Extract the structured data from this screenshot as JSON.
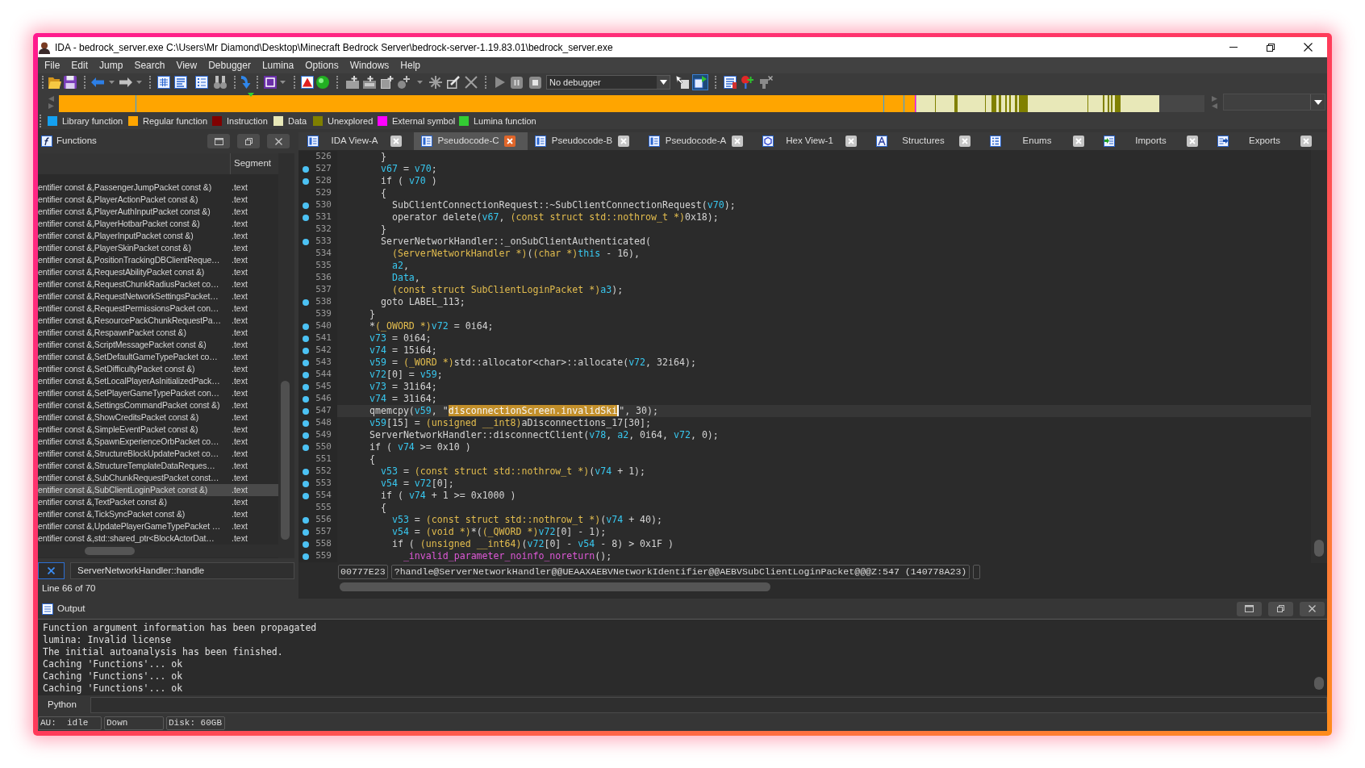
{
  "window": {
    "title": "IDA - bedrock_server.exe C:\\Users\\Mr Diamond\\Desktop\\Minecraft Bedrock Server\\bedrock-server-1.19.83.01\\bedrock_server.exe"
  },
  "menu": [
    "File",
    "Edit",
    "Jump",
    "Search",
    "View",
    "Debugger",
    "Lumina",
    "Options",
    "Windows",
    "Help"
  ],
  "toolbar": {
    "debugger": "No debugger"
  },
  "legend": [
    {
      "label": "Library function",
      "color": "#14a0f0"
    },
    {
      "label": "Regular function",
      "color": "#ffa500"
    },
    {
      "label": "Instruction",
      "color": "#800000"
    },
    {
      "label": "Data",
      "color": "#e8e8b8"
    },
    {
      "label": "Unexplored",
      "color": "#808000"
    },
    {
      "label": "External symbol",
      "color": "#ff00ff"
    },
    {
      "label": "Lumina function",
      "color": "#33cc33"
    }
  ],
  "functions_panel": {
    "title": "Functions",
    "segment_header": "Segment",
    "rows": [
      {
        "name": "entifier const &,PassengerJumpPacket const &)",
        "segment": ".text",
        "selected": false
      },
      {
        "name": "entifier const &,PlayerActionPacket const &)",
        "segment": ".text",
        "selected": false
      },
      {
        "name": "entifier const &,PlayerAuthInputPacket const &)",
        "segment": ".text",
        "selected": false
      },
      {
        "name": "entifier const &,PlayerHotbarPacket const &)",
        "segment": ".text",
        "selected": false
      },
      {
        "name": "entifier const &,PlayerInputPacket const &)",
        "segment": ".text",
        "selected": false
      },
      {
        "name": "entifier const &,PlayerSkinPacket const &)",
        "segment": ".text",
        "selected": false
      },
      {
        "name": "entifier const &,PositionTrackingDBClientReque…",
        "segment": ".text",
        "selected": false
      },
      {
        "name": "entifier const &,RequestAbilityPacket const &)",
        "segment": ".text",
        "selected": false
      },
      {
        "name": "entifier const &,RequestChunkRadiusPacket co…",
        "segment": ".text",
        "selected": false
      },
      {
        "name": "entifier const &,RequestNetworkSettingsPacket…",
        "segment": ".text",
        "selected": false
      },
      {
        "name": "entifier const &,RequestPermissionsPacket con…",
        "segment": ".text",
        "selected": false
      },
      {
        "name": "entifier const &,ResourcePackChunkRequestPa…",
        "segment": ".text",
        "selected": false
      },
      {
        "name": "entifier const &,RespawnPacket const &)",
        "segment": ".text",
        "selected": false
      },
      {
        "name": "entifier const &,ScriptMessagePacket const &)",
        "segment": ".text",
        "selected": false
      },
      {
        "name": "entifier const &,SetDefaultGameTypePacket co…",
        "segment": ".text",
        "selected": false
      },
      {
        "name": "entifier const &,SetDifficultyPacket const &)",
        "segment": ".text",
        "selected": false
      },
      {
        "name": "entifier const &,SetLocalPlayerAsInitializedPack…",
        "segment": ".text",
        "selected": false
      },
      {
        "name": "entifier const &,SetPlayerGameTypePacket con…",
        "segment": ".text",
        "selected": false
      },
      {
        "name": "entifier const &,SettingsCommandPacket const &)",
        "segment": ".text",
        "selected": false
      },
      {
        "name": "entifier const &,ShowCreditsPacket const &)",
        "segment": ".text",
        "selected": false
      },
      {
        "name": "entifier const &,SimpleEventPacket const &)",
        "segment": ".text",
        "selected": false
      },
      {
        "name": "entifier const &,SpawnExperienceOrbPacket co…",
        "segment": ".text",
        "selected": false
      },
      {
        "name": "entifier const &,StructureBlockUpdatePacket co…",
        "segment": ".text",
        "selected": false
      },
      {
        "name": "entifier const &,StructureTemplateDataReques…",
        "segment": ".text",
        "selected": false
      },
      {
        "name": "entifier const &,SubChunkRequestPacket const…",
        "segment": ".text",
        "selected": false
      },
      {
        "name": "entifier const &,SubClientLoginPacket const &)",
        "segment": ".text",
        "selected": true
      },
      {
        "name": "entifier const &,TextPacket const &)",
        "segment": ".text",
        "selected": false
      },
      {
        "name": "entifier const &,TickSyncPacket const &)",
        "segment": ".text",
        "selected": false
      },
      {
        "name": "entifier const &,UpdatePlayerGameTypePacket …",
        "segment": ".text",
        "selected": false
      },
      {
        "name": "entifier const &,std::shared_ptr<BlockActorDat…",
        "segment": ".text",
        "selected": false
      }
    ],
    "filter": "ServerNetworkHandler::handle",
    "status": "Line 66 of 70"
  },
  "tabs": [
    {
      "label": "IDA View-A",
      "selected": false
    },
    {
      "label": "Pseudocode-C",
      "selected": true
    },
    {
      "label": "Pseudocode-B",
      "selected": false
    },
    {
      "label": "Pseudocode-A",
      "selected": false
    },
    {
      "label": "Hex View-1",
      "selected": false
    },
    {
      "label": "Structures",
      "selected": false
    },
    {
      "label": "Enums",
      "selected": false
    },
    {
      "label": "Imports",
      "selected": false
    },
    {
      "label": "Exports",
      "selected": false
    }
  ],
  "pseudocode": {
    "lines": [
      {
        "number": "526",
        "marker": false,
        "current": false,
        "tokens": [
          {
            "kind": "plain",
            "text": "  }"
          }
        ]
      },
      {
        "number": "527",
        "marker": true,
        "current": false,
        "tokens": [
          {
            "kind": "var",
            "text": "  v67"
          },
          {
            "kind": "plain",
            "text": " = "
          },
          {
            "kind": "var",
            "text": "v70"
          },
          {
            "kind": "plain",
            "text": ";"
          }
        ]
      },
      {
        "number": "528",
        "marker": true,
        "current": false,
        "tokens": [
          {
            "kind": "plain",
            "text": "  if ( "
          },
          {
            "kind": "var",
            "text": "v70"
          },
          {
            "kind": "plain",
            "text": " )"
          }
        ]
      },
      {
        "number": "529",
        "marker": false,
        "current": false,
        "tokens": [
          {
            "kind": "plain",
            "text": "  {"
          }
        ]
      },
      {
        "number": "530",
        "marker": true,
        "current": false,
        "tokens": [
          {
            "kind": "plain",
            "text": "    SubClientConnectionRequest::~SubClientConnectionRequest("
          },
          {
            "kind": "var",
            "text": "v70"
          },
          {
            "kind": "plain",
            "text": ");"
          }
        ]
      },
      {
        "number": "531",
        "marker": true,
        "current": false,
        "tokens": [
          {
            "kind": "plain",
            "text": "    operator delete("
          },
          {
            "kind": "var",
            "text": "v67"
          },
          {
            "kind": "plain",
            "text": ", "
          },
          {
            "kind": "type",
            "text": "(const struct std::nothrow_t *)"
          },
          {
            "kind": "plain",
            "text": "0x18);"
          }
        ]
      },
      {
        "number": "532",
        "marker": false,
        "current": false,
        "tokens": [
          {
            "kind": "plain",
            "text": "  }"
          }
        ]
      },
      {
        "number": "533",
        "marker": true,
        "current": false,
        "tokens": [
          {
            "kind": "plain",
            "text": "  ServerNetworkHandler::_onSubClientAuthenticated("
          }
        ]
      },
      {
        "number": "534",
        "marker": false,
        "current": false,
        "tokens": [
          {
            "kind": "type",
            "text": "    (ServerNetworkHandler *)"
          },
          {
            "kind": "plain",
            "text": "("
          },
          {
            "kind": "type",
            "text": "(char *)"
          },
          {
            "kind": "var",
            "text": "this"
          },
          {
            "kind": "plain",
            "text": " - 16),"
          }
        ]
      },
      {
        "number": "535",
        "marker": false,
        "current": false,
        "tokens": [
          {
            "kind": "var",
            "text": "    a2"
          },
          {
            "kind": "plain",
            "text": ","
          }
        ]
      },
      {
        "number": "536",
        "marker": false,
        "current": false,
        "tokens": [
          {
            "kind": "var",
            "text": "    Data"
          },
          {
            "kind": "plain",
            "text": ","
          }
        ]
      },
      {
        "number": "537",
        "marker": false,
        "current": false,
        "tokens": [
          {
            "kind": "type",
            "text": "    (const struct SubClientLoginPacket *)"
          },
          {
            "kind": "var",
            "text": "a3"
          },
          {
            "kind": "plain",
            "text": ");"
          }
        ]
      },
      {
        "number": "538",
        "marker": true,
        "current": false,
        "tokens": [
          {
            "kind": "plain",
            "text": "  goto LABEL_113;"
          }
        ]
      },
      {
        "number": "539",
        "marker": false,
        "current": false,
        "tokens": [
          {
            "kind": "plain",
            "text": "}"
          }
        ]
      },
      {
        "number": "540",
        "marker": true,
        "current": false,
        "tokens": [
          {
            "kind": "plain",
            "text": "*"
          },
          {
            "kind": "type",
            "text": "(_OWORD *)"
          },
          {
            "kind": "var",
            "text": "v72"
          },
          {
            "kind": "plain",
            "text": " = 0i64;"
          }
        ]
      },
      {
        "number": "541",
        "marker": true,
        "current": false,
        "tokens": [
          {
            "kind": "var",
            "text": "v73"
          },
          {
            "kind": "plain",
            "text": " = 0i64;"
          }
        ]
      },
      {
        "number": "542",
        "marker": true,
        "current": false,
        "tokens": [
          {
            "kind": "var",
            "text": "v74"
          },
          {
            "kind": "plain",
            "text": " = 15i64;"
          }
        ]
      },
      {
        "number": "543",
        "marker": true,
        "current": false,
        "tokens": [
          {
            "kind": "var",
            "text": "v59"
          },
          {
            "kind": "plain",
            "text": " = "
          },
          {
            "kind": "type",
            "text": "(_WORD *)"
          },
          {
            "kind": "plain",
            "text": "std::allocator<char>::allocate("
          },
          {
            "kind": "var",
            "text": "v72"
          },
          {
            "kind": "plain",
            "text": ", 32i64);"
          }
        ]
      },
      {
        "number": "544",
        "marker": true,
        "current": false,
        "tokens": [
          {
            "kind": "var",
            "text": "v72"
          },
          {
            "kind": "plain",
            "text": "[0] = "
          },
          {
            "kind": "var",
            "text": "v59"
          },
          {
            "kind": "plain",
            "text": ";"
          }
        ]
      },
      {
        "number": "545",
        "marker": true,
        "current": false,
        "tokens": [
          {
            "kind": "var",
            "text": "v73"
          },
          {
            "kind": "plain",
            "text": " = 31i64;"
          }
        ]
      },
      {
        "number": "546",
        "marker": true,
        "current": false,
        "tokens": [
          {
            "kind": "var",
            "text": "v74"
          },
          {
            "kind": "plain",
            "text": " = 31i64;"
          }
        ]
      },
      {
        "number": "547",
        "marker": true,
        "current": true,
        "tokens": [
          {
            "kind": "plain",
            "text": "qmemcpy("
          },
          {
            "kind": "var",
            "text": "v59"
          },
          {
            "kind": "plain",
            "text": ", \""
          },
          {
            "kind": "highlight",
            "text": "disconnectionScreen.invalidSki"
          },
          {
            "kind": "plain",
            "text": "\", 30);"
          }
        ]
      },
      {
        "number": "548",
        "marker": true,
        "current": false,
        "tokens": [
          {
            "kind": "var",
            "text": "v59"
          },
          {
            "kind": "plain",
            "text": "[15] = "
          },
          {
            "kind": "type",
            "text": "(unsigned __int8)"
          },
          {
            "kind": "plain",
            "text": "aDisconnections_17[30];"
          }
        ]
      },
      {
        "number": "549",
        "marker": true,
        "current": false,
        "tokens": [
          {
            "kind": "plain",
            "text": "ServerNetworkHandler::disconnectClient("
          },
          {
            "kind": "var",
            "text": "v78"
          },
          {
            "kind": "plain",
            "text": ", "
          },
          {
            "kind": "var",
            "text": "a2"
          },
          {
            "kind": "plain",
            "text": ", 0i64, "
          },
          {
            "kind": "var",
            "text": "v72"
          },
          {
            "kind": "plain",
            "text": ", 0);"
          }
        ]
      },
      {
        "number": "550",
        "marker": true,
        "current": false,
        "tokens": [
          {
            "kind": "plain",
            "text": "if ( "
          },
          {
            "kind": "var",
            "text": "v74"
          },
          {
            "kind": "plain",
            "text": " >= 0x10 )"
          }
        ]
      },
      {
        "number": "551",
        "marker": false,
        "current": false,
        "tokens": [
          {
            "kind": "plain",
            "text": "{"
          }
        ]
      },
      {
        "number": "552",
        "marker": true,
        "current": false,
        "tokens": [
          {
            "kind": "var",
            "text": "  v53"
          },
          {
            "kind": "plain",
            "text": " = "
          },
          {
            "kind": "type",
            "text": "(const struct std::nothrow_t *)"
          },
          {
            "kind": "plain",
            "text": "("
          },
          {
            "kind": "var",
            "text": "v74"
          },
          {
            "kind": "plain",
            "text": " + 1);"
          }
        ]
      },
      {
        "number": "553",
        "marker": true,
        "current": false,
        "tokens": [
          {
            "kind": "var",
            "text": "  v54"
          },
          {
            "kind": "plain",
            "text": " = "
          },
          {
            "kind": "var",
            "text": "v72"
          },
          {
            "kind": "plain",
            "text": "[0];"
          }
        ]
      },
      {
        "number": "554",
        "marker": true,
        "current": false,
        "tokens": [
          {
            "kind": "plain",
            "text": "  if ( "
          },
          {
            "kind": "var",
            "text": "v74"
          },
          {
            "kind": "plain",
            "text": " + 1 >= 0x1000 )"
          }
        ]
      },
      {
        "number": "555",
        "marker": false,
        "current": false,
        "tokens": [
          {
            "kind": "plain",
            "text": "  {"
          }
        ]
      },
      {
        "number": "556",
        "marker": true,
        "current": false,
        "tokens": [
          {
            "kind": "var",
            "text": "    v53"
          },
          {
            "kind": "plain",
            "text": " = "
          },
          {
            "kind": "type",
            "text": "(const struct std::nothrow_t *)"
          },
          {
            "kind": "plain",
            "text": "("
          },
          {
            "kind": "var",
            "text": "v74"
          },
          {
            "kind": "plain",
            "text": " + 40);"
          }
        ]
      },
      {
        "number": "557",
        "marker": true,
        "current": false,
        "tokens": [
          {
            "kind": "var",
            "text": "    v54"
          },
          {
            "kind": "plain",
            "text": " = "
          },
          {
            "kind": "type",
            "text": "(void *)"
          },
          {
            "kind": "plain",
            "text": "*("
          },
          {
            "kind": "type",
            "text": "(_QWORD *)"
          },
          {
            "kind": "var",
            "text": "v72"
          },
          {
            "kind": "plain",
            "text": "[0] - 1);"
          }
        ]
      },
      {
        "number": "558",
        "marker": true,
        "current": false,
        "tokens": [
          {
            "kind": "plain",
            "text": "    if ( "
          },
          {
            "kind": "type",
            "text": "(unsigned __int64)"
          },
          {
            "kind": "plain",
            "text": "("
          },
          {
            "kind": "var",
            "text": "v72"
          },
          {
            "kind": "plain",
            "text": "[0] - "
          },
          {
            "kind": "var",
            "text": "v54"
          },
          {
            "kind": "plain",
            "text": " - 8) > 0x1F )"
          }
        ]
      },
      {
        "number": "559",
        "marker": true,
        "current": false,
        "tokens": [
          {
            "kind": "func",
            "text": "      _invalid_parameter_noinfo_noreturn"
          },
          {
            "kind": "plain",
            "text": "();"
          }
        ]
      }
    ],
    "address": "00777E23",
    "location": "?handle@ServerNetworkHandler@@UEAAXAEBVNetworkIdentifier@@AEBVSubClientLoginPacket@@@Z:547 (140778A23)"
  },
  "output": {
    "title": "Output",
    "lines": [
      "Function argument information has been propagated",
      "lumina: Invalid license",
      "The initial autoanalysis has been finished.",
      "Caching 'Functions'... ok",
      "Caching 'Functions'... ok",
      "Caching 'Functions'... ok"
    ]
  },
  "python": {
    "label": "Python"
  },
  "status_bar": [
    "AU:  idle",
    "Down",
    "Disk: 60GB"
  ]
}
